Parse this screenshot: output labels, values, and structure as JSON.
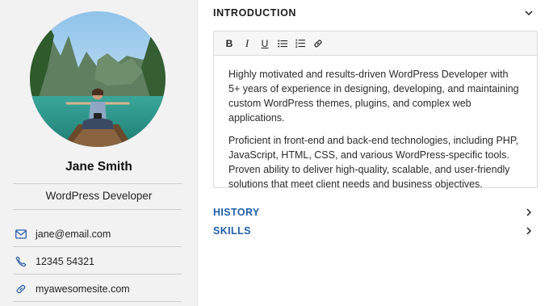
{
  "profile": {
    "name": "Jane Smith",
    "role": "WordPress Developer",
    "photo_icon": "profile-photo",
    "contacts": [
      {
        "icon": "mail-icon",
        "text": "jane@email.com"
      },
      {
        "icon": "phone-icon",
        "text": "12345 54321"
      },
      {
        "icon": "link-icon",
        "text": "myawesomesite.com"
      }
    ]
  },
  "introduction": {
    "title": "INTRODUCTION",
    "toolbar": {
      "bold": "B",
      "italic": "I",
      "underline": "U"
    },
    "paragraphs": [
      "Highly motivated and results-driven WordPress Developer with 5+ years of experience in designing, developing, and maintaining custom WordPress themes, plugins, and complex web applications.",
      "Proficient in front-end and back-end technologies, including PHP, JavaScript, HTML, CSS, and various WordPress-specific tools. Proven ability to deliver high-quality, scalable, and user-friendly solutions that meet client needs and business objectives."
    ]
  },
  "sections": [
    {
      "title": "HISTORY"
    },
    {
      "title": "SKILLS"
    }
  ],
  "colors": {
    "accent": "#1f5fa8",
    "sidebar": "#f2f2f2"
  }
}
